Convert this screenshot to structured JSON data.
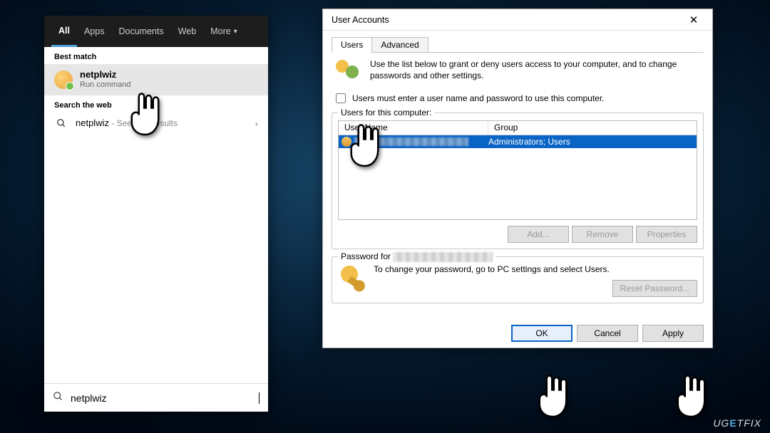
{
  "search": {
    "tabs": {
      "all": "All",
      "apps": "Apps",
      "documents": "Documents",
      "web": "Web",
      "more": "More"
    },
    "best_match_header": "Best match",
    "best": {
      "title": "netplwiz",
      "subtitle": "Run command"
    },
    "search_web_header": "Search the web",
    "web": {
      "term": "netplwiz",
      "suffix": " - See web results"
    },
    "input_value": "netplwiz"
  },
  "dialog": {
    "title": "User Accounts",
    "tabs": {
      "users": "Users",
      "advanced": "Advanced"
    },
    "intro": "Use the list below to grant or deny users access to your computer, and to change passwords and other settings.",
    "checkbox_label": "Users must enter a user name and password to use this computer.",
    "users_group_label": "Users for this computer:",
    "col_name": "User Name",
    "col_group": "Group",
    "row_group": "Administrators; Users",
    "buttons": {
      "add": "Add...",
      "remove": "Remove",
      "properties": "Properties"
    },
    "pw_group_prefix": "Password for ",
    "pw_text": "To change your password, go to PC settings and select Users.",
    "reset_pw": "Reset Password...",
    "footer": {
      "ok": "OK",
      "cancel": "Cancel",
      "apply": "Apply"
    }
  },
  "watermark": "UG  TFIX",
  "watermark_e": "E"
}
